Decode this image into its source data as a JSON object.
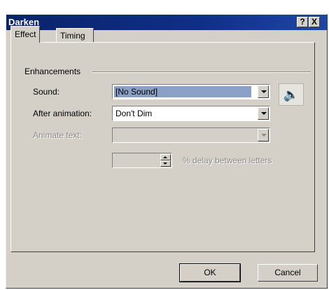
{
  "dialog": {
    "title": "Darken",
    "help_label": "?",
    "close_label": "X"
  },
  "tabs": [
    {
      "label": "Effect",
      "active": true
    },
    {
      "label": "Timing",
      "active": false
    }
  ],
  "enhancements": {
    "group_label": "Enhancements",
    "sound": {
      "label": "Sound:",
      "value": "[No Sound]"
    },
    "after_animation": {
      "label": "After animation:",
      "value": "Don't Dim"
    },
    "animate_text": {
      "label": "Animate text:",
      "value": "",
      "disabled": true
    },
    "delay": {
      "value": "",
      "label": "% delay between letters",
      "disabled": true
    },
    "sound_button_icon": "speaker-icon",
    "sound_button_glyph": "🔈"
  },
  "buttons": {
    "ok": "OK",
    "cancel": "Cancel"
  },
  "colors": {
    "titlebar": "#0a246a",
    "dialog_face": "#d4d0c8",
    "selection": "#8aa0c6"
  }
}
